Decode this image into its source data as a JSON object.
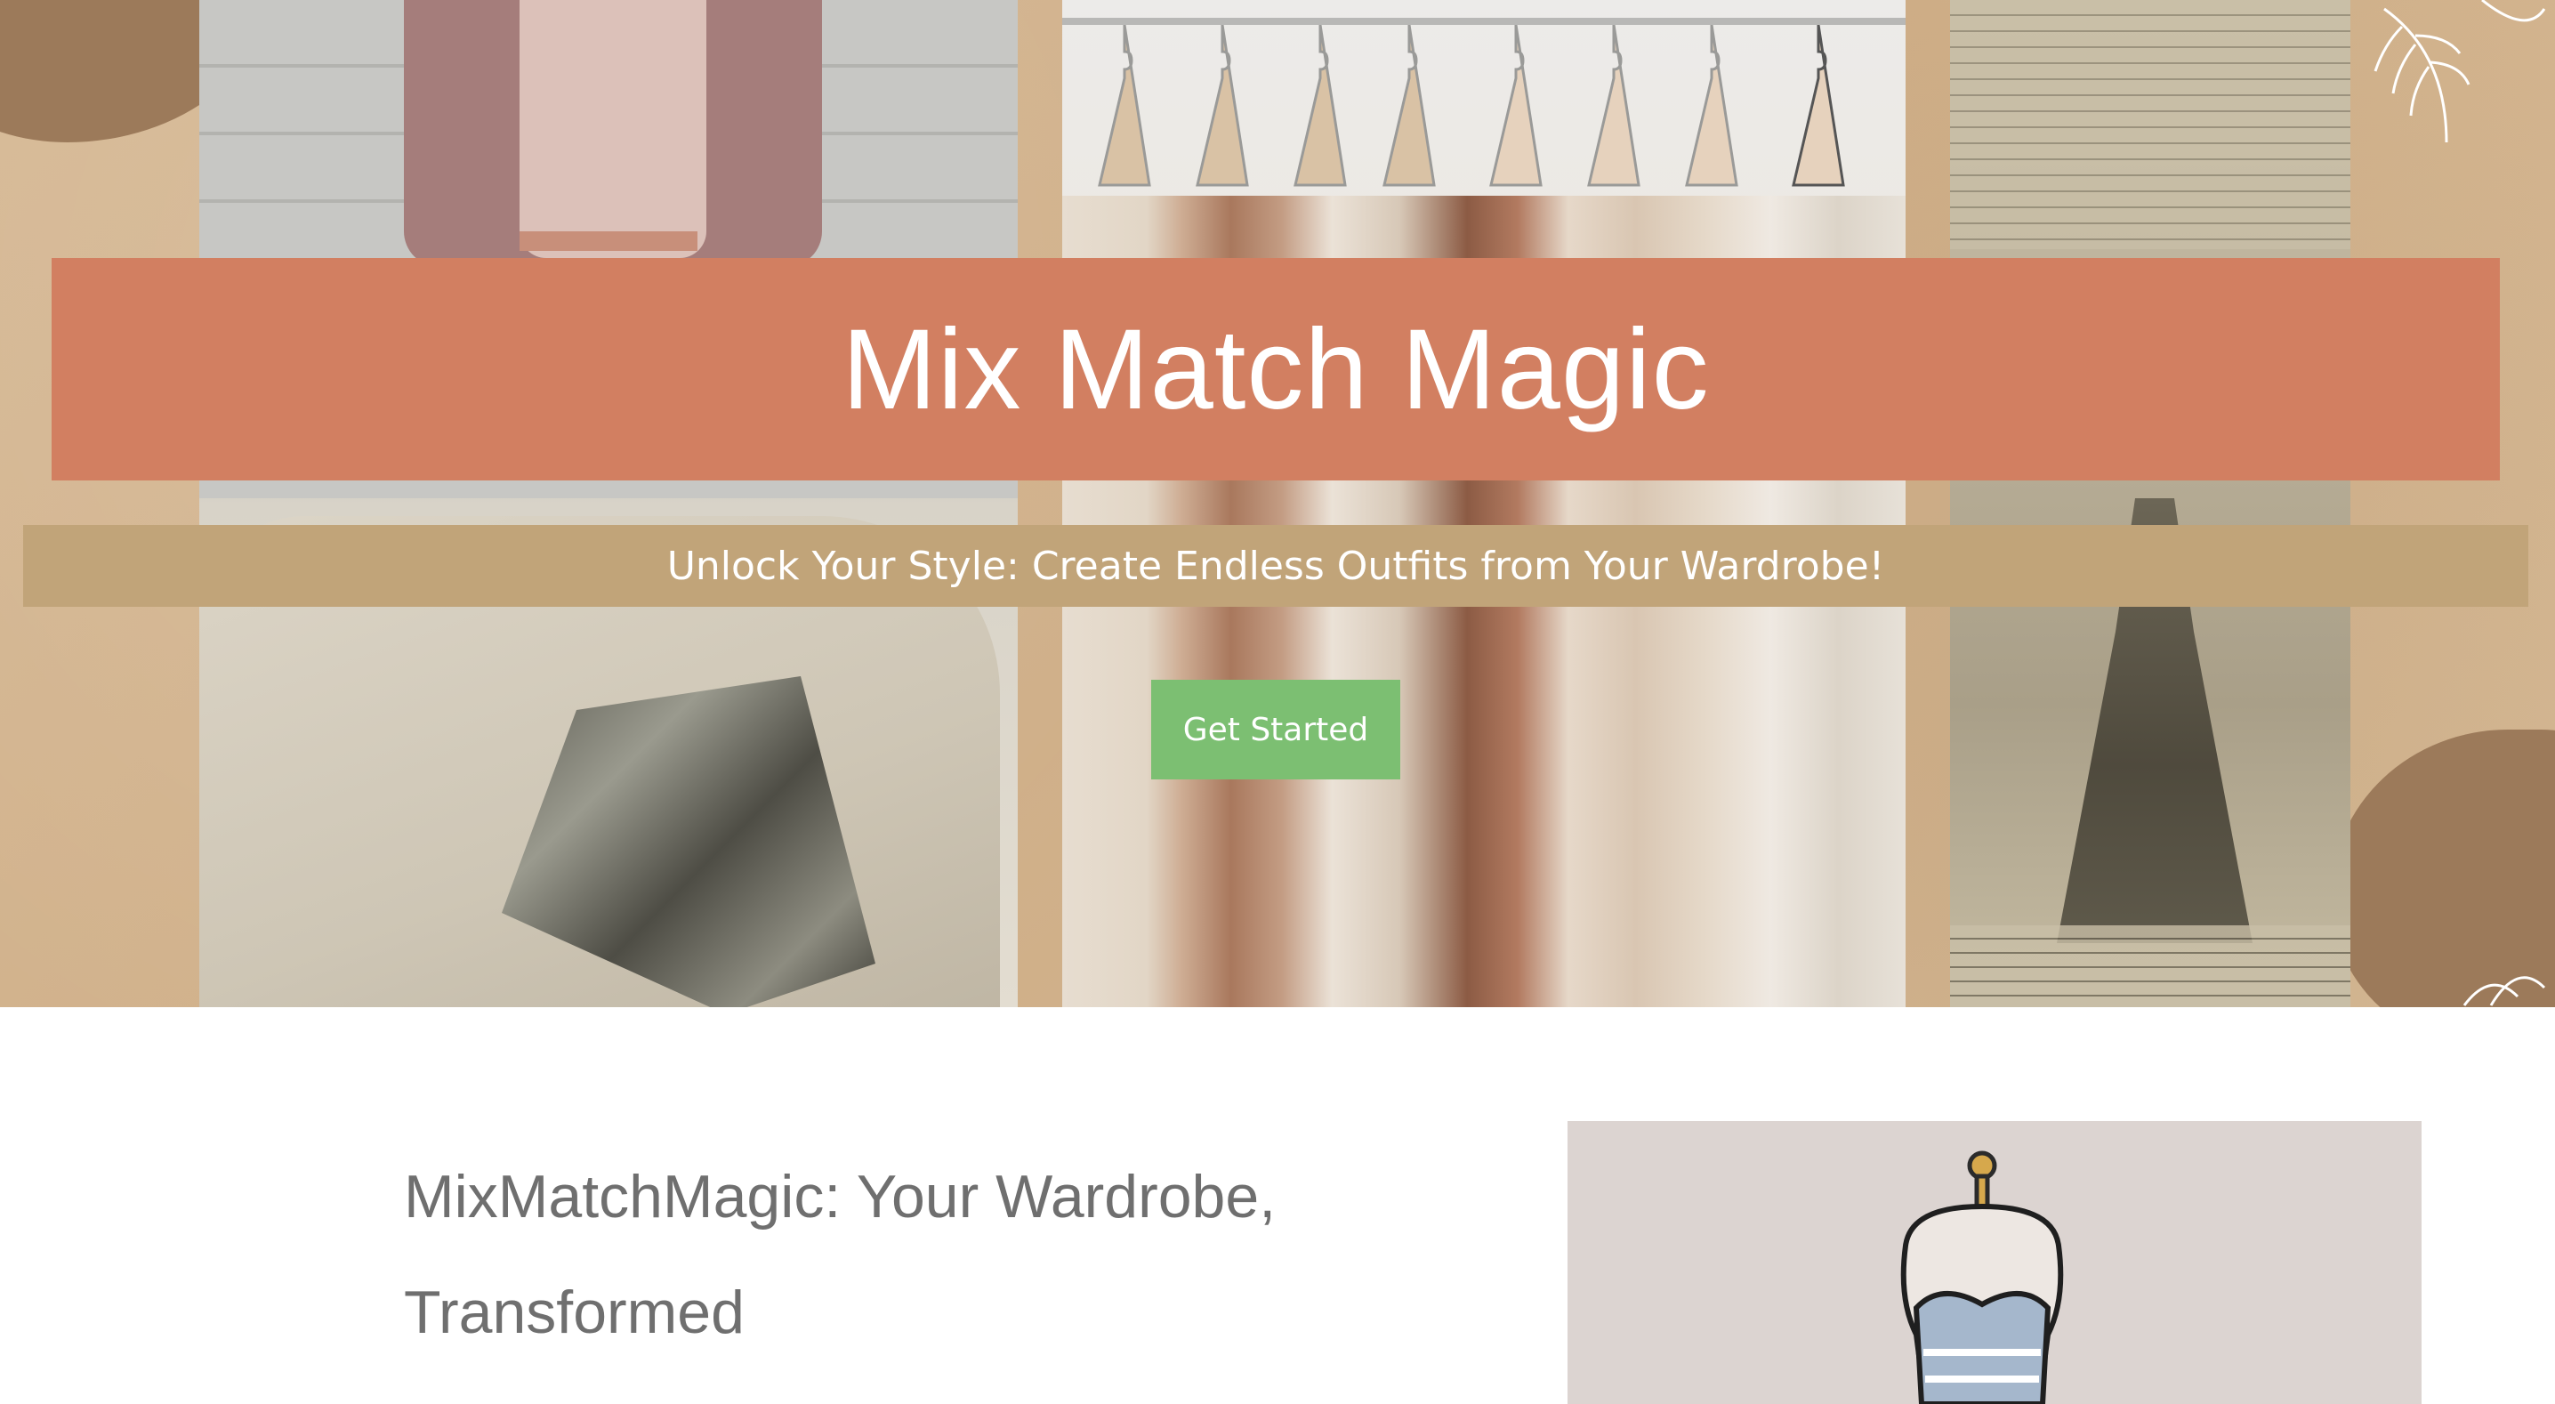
{
  "hero": {
    "title": "Mix Match Magic",
    "subtitle": "Unlock Your Style: Create Endless Outfits from Your Wardrobe!",
    "cta_label": "Get Started"
  },
  "about": {
    "heading_line1": "MixMatchMagic: Your Wardrobe,",
    "heading_line2": "Transformed"
  },
  "colors": {
    "title_banner": "#d27f61",
    "subtitle_banner": "#c1a479",
    "cta_button": "#7cbf72",
    "hero_background": "#d6b995",
    "heading_text": "#6f6f6f"
  },
  "icons": {
    "hero_images": [
      "outfit-photo",
      "clothing-rack-photo",
      "vintage-fashion-print"
    ],
    "illustration": "dress-form-icon"
  }
}
